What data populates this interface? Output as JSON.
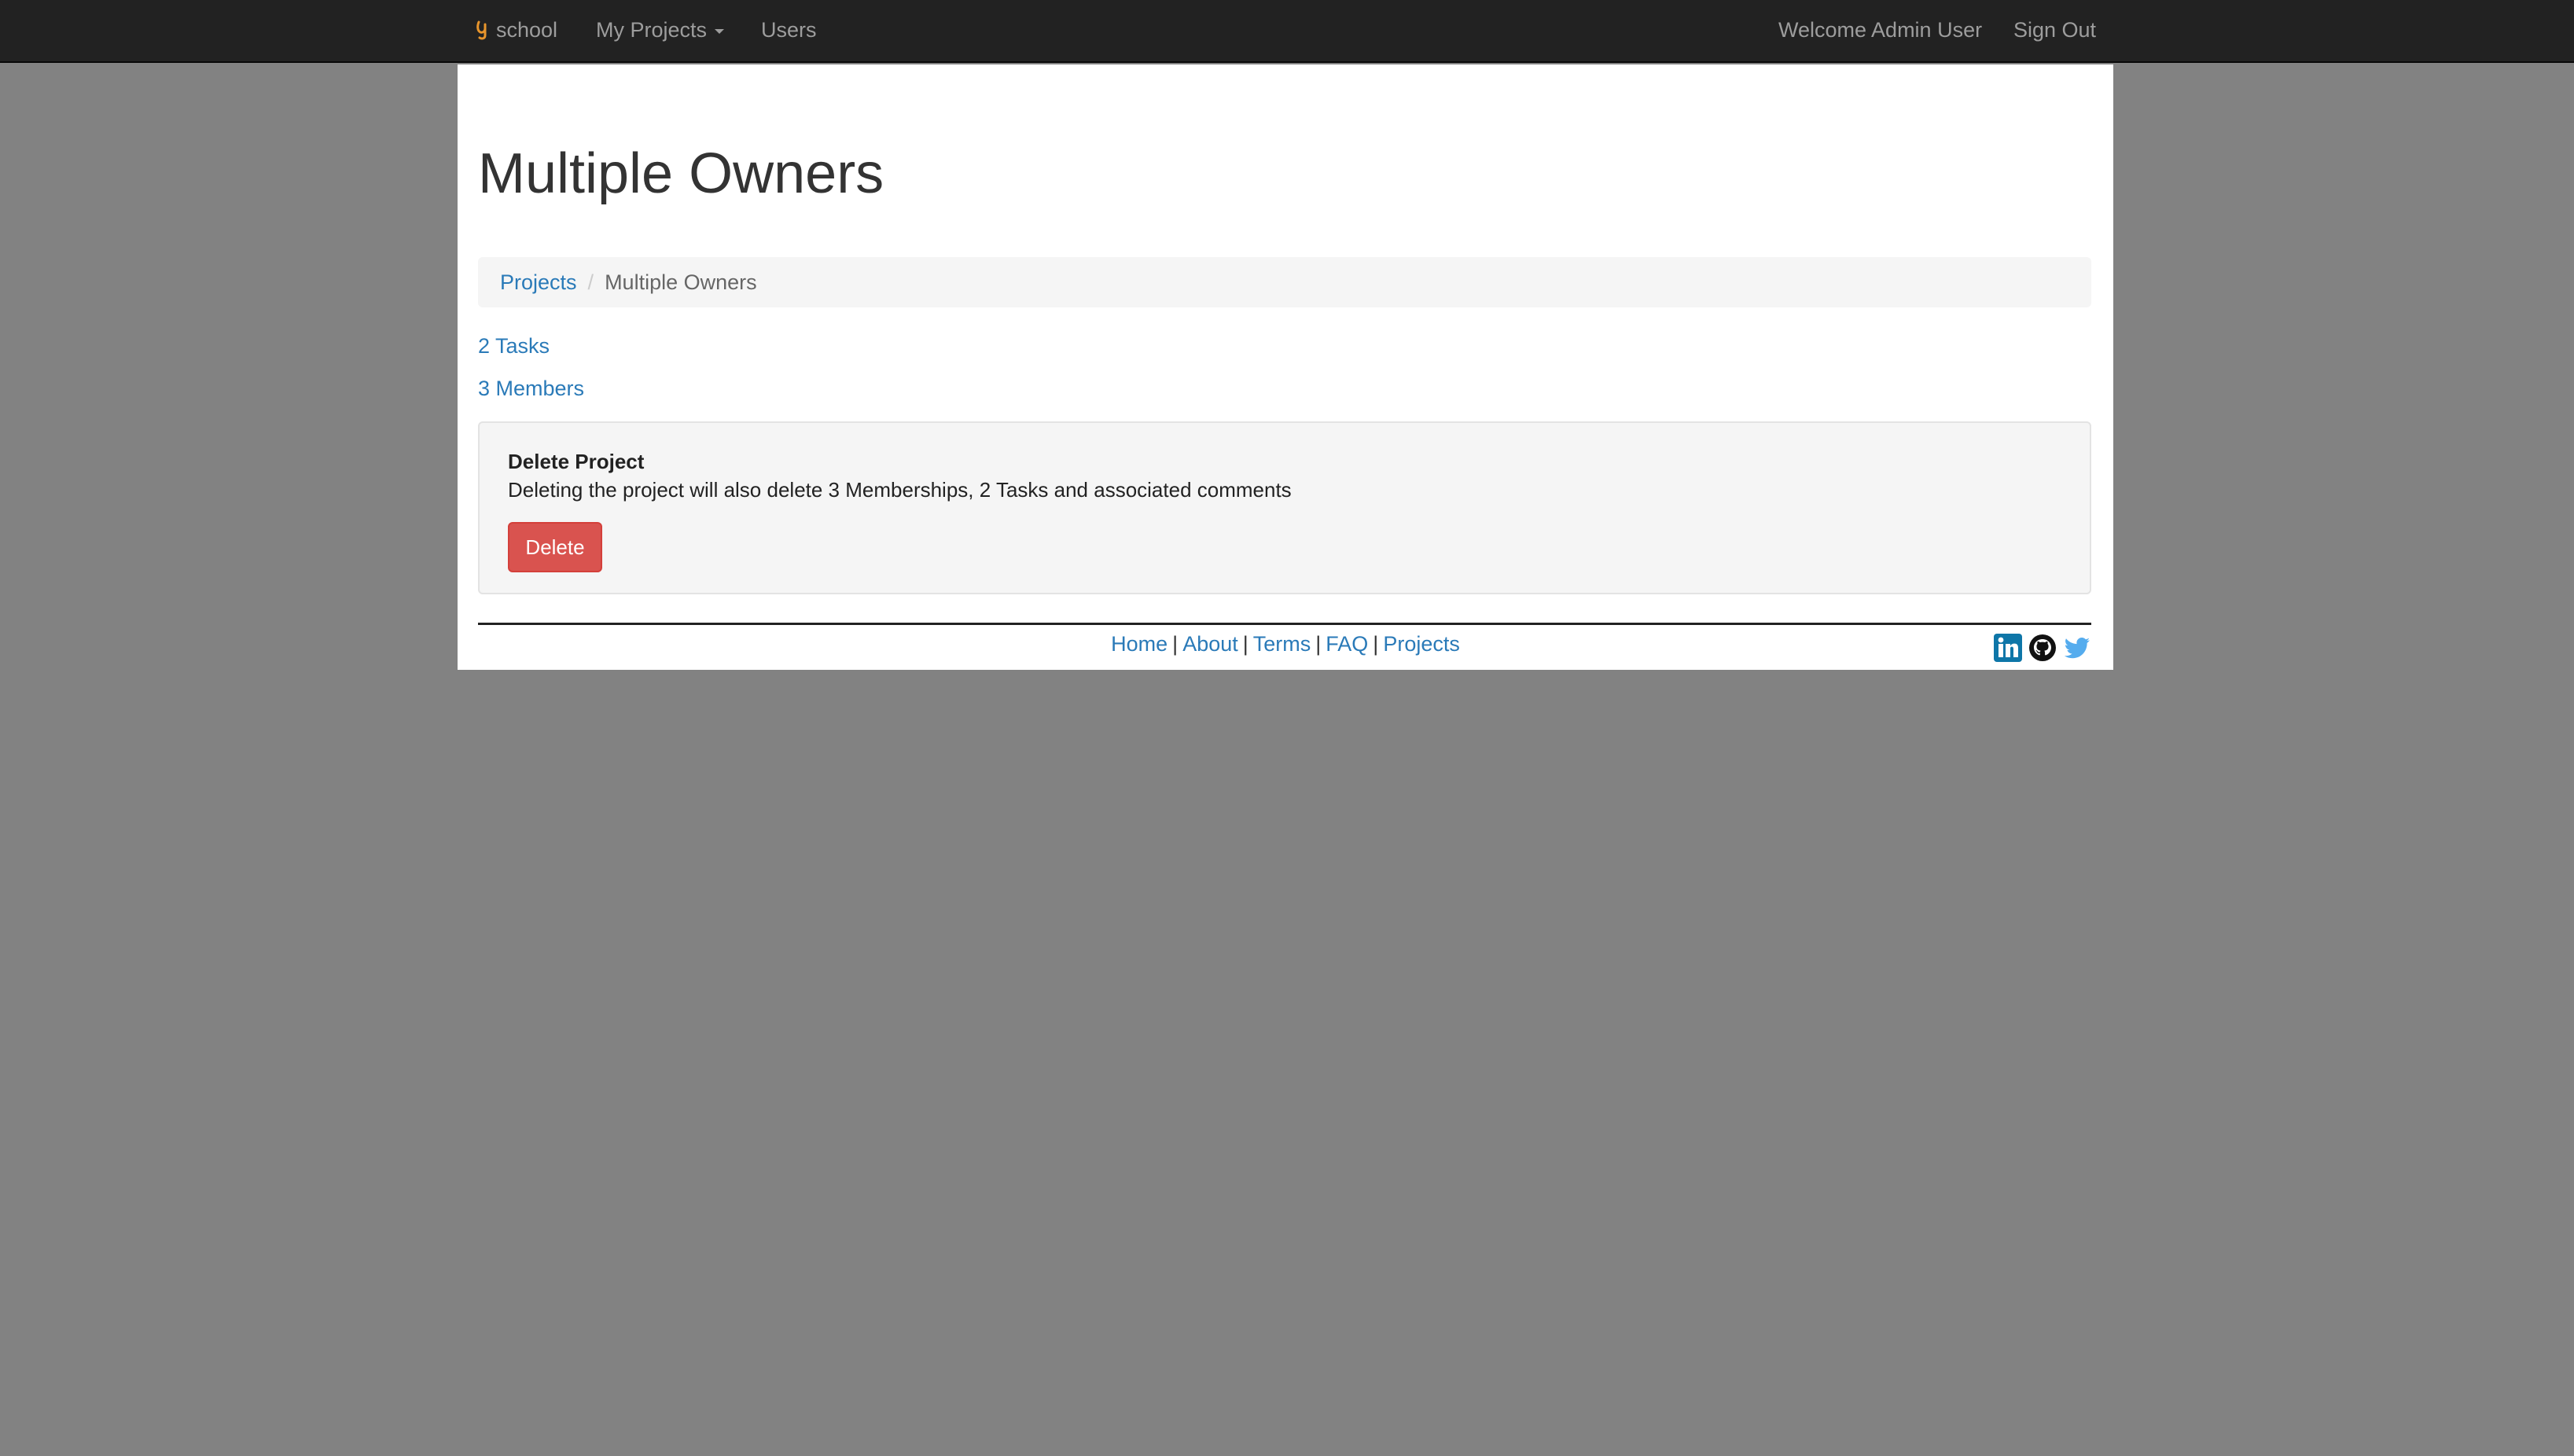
{
  "navbar": {
    "brand": "school",
    "my_projects": "My Projects",
    "users": "Users",
    "welcome": "Welcome Admin User",
    "sign_out": "Sign Out"
  },
  "page": {
    "title": "Multiple Owners"
  },
  "breadcrumb": {
    "projects": "Projects",
    "separator": "/",
    "current": "Multiple Owners"
  },
  "summary": {
    "tasks_link": "2 Tasks",
    "members_link": "3 Members"
  },
  "delete_panel": {
    "title": "Delete Project",
    "message": "Deleting the project will also delete 3 Memberships, 2 Tasks and associated comments",
    "button": "Delete"
  },
  "footer": {
    "links": [
      "Home",
      "About",
      "Terms",
      "FAQ",
      "Projects"
    ],
    "separator": "|",
    "social_icons": [
      "linkedin-icon",
      "github-icon",
      "twitter-icon"
    ]
  },
  "colors": {
    "navbar_bg": "#222222",
    "link": "#2a7ab8",
    "danger": "#d9534f",
    "backdrop": "#828282",
    "brand_logo": "#e8952c",
    "linkedin": "#0e76a8",
    "twitter": "#55acee"
  }
}
